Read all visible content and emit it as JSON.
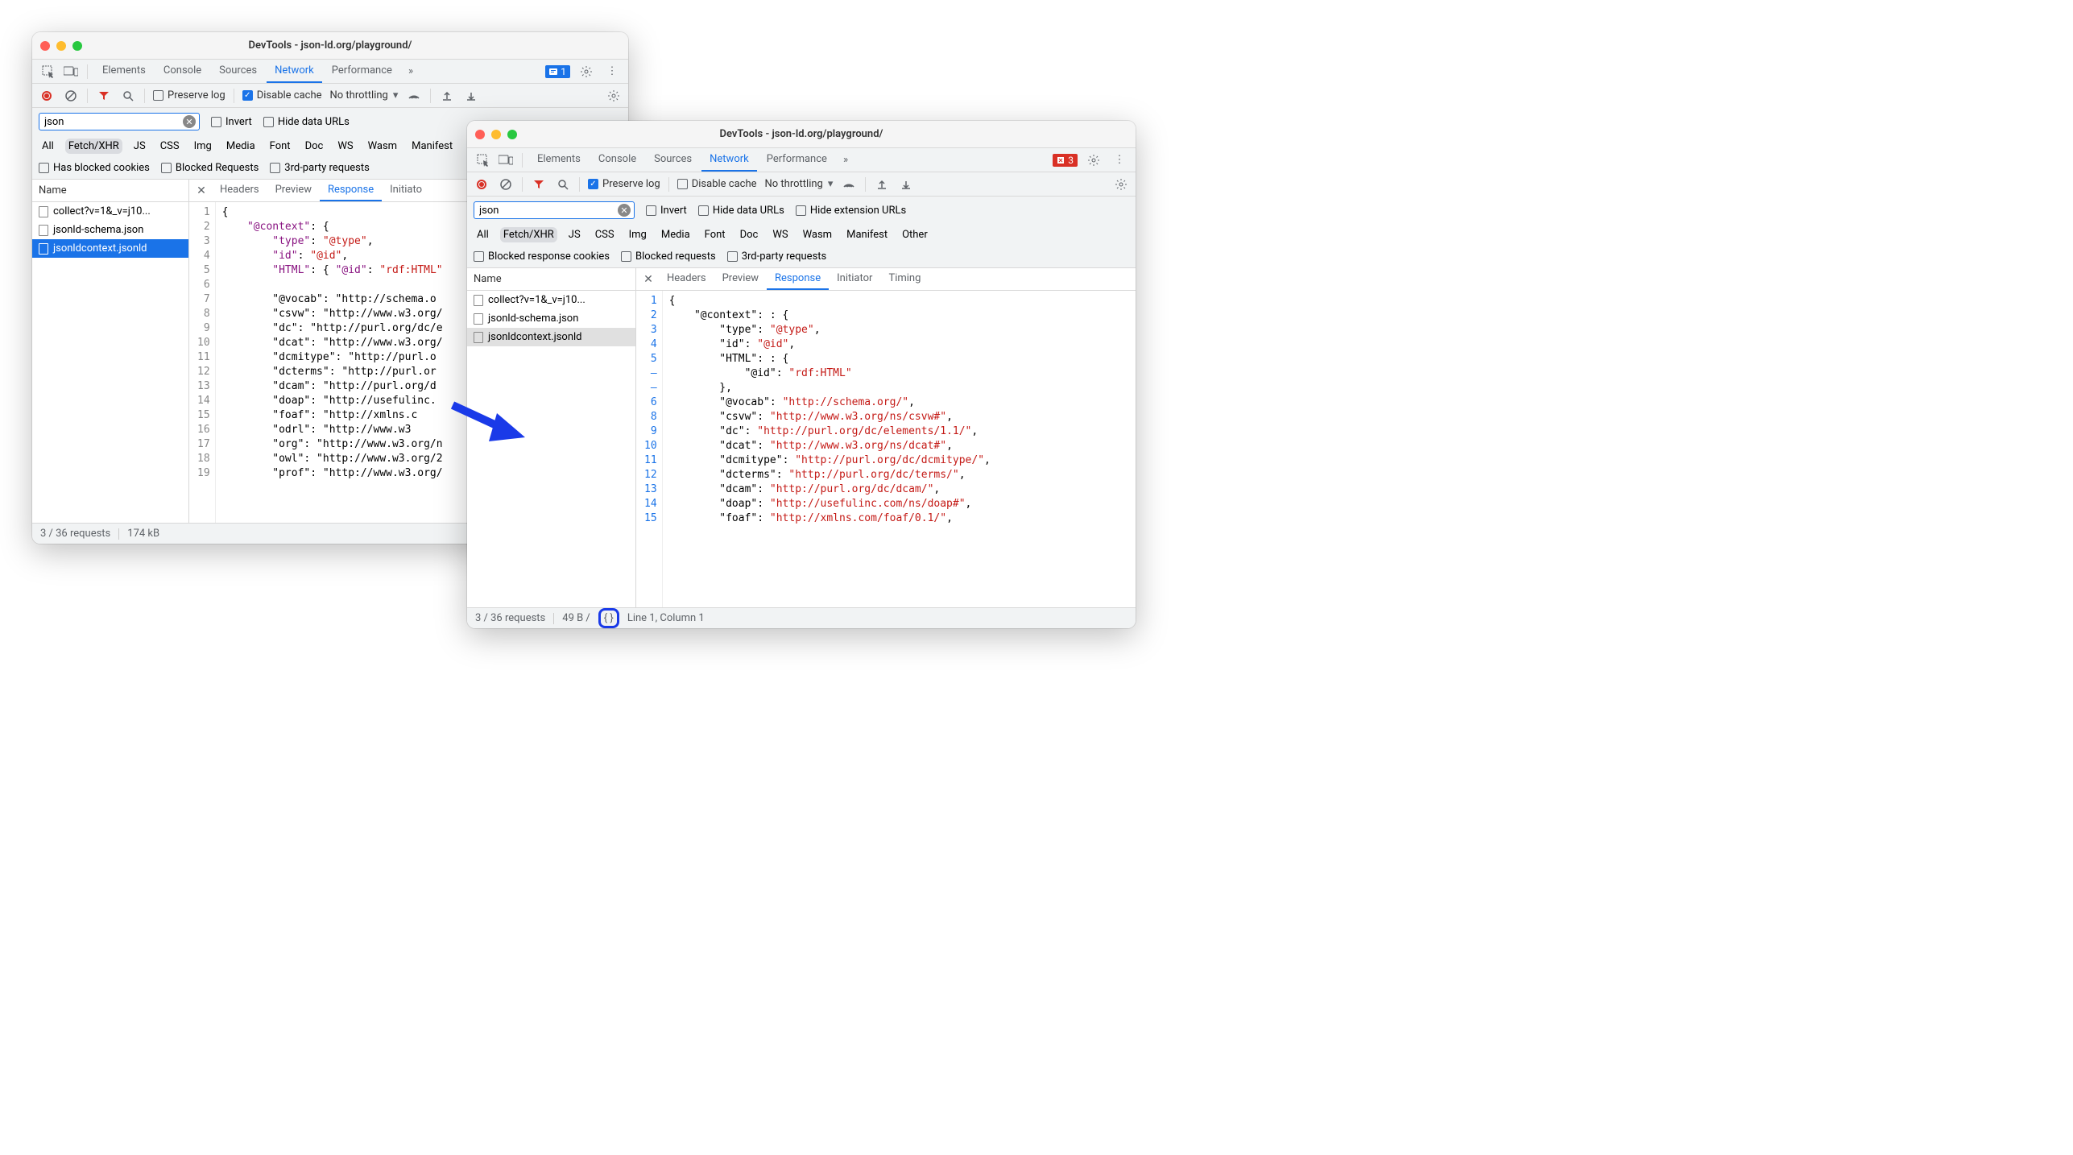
{
  "winA": {
    "title": "DevTools - json-ld.org/playground/",
    "tabs": [
      "Elements",
      "Console",
      "Sources",
      "Network",
      "Performance"
    ],
    "activeTab": "Network",
    "badge": "1",
    "preserve": "Preserve log",
    "disableCache": "Disable cache",
    "throttling": "No throttling",
    "filter": "json",
    "invert": "Invert",
    "hideData": "Hide data URLs",
    "typeFilters": [
      "All",
      "Fetch/XHR",
      "JS",
      "CSS",
      "Img",
      "Media",
      "Font",
      "Doc",
      "WS",
      "Wasm",
      "Manifest"
    ],
    "typeSel": "Fetch/XHR",
    "row2": {
      "hasBlocked": "Has blocked cookies",
      "blockedReq": "Blocked Requests",
      "third": "3rd-party requests"
    },
    "nameCol": "Name",
    "requests": [
      {
        "name": "collect?v=1&_v=j10..."
      },
      {
        "name": "jsonld-schema.json"
      },
      {
        "name": "jsonldcontext.jsonld"
      }
    ],
    "selReq": 2,
    "detailTabs": [
      "Headers",
      "Preview",
      "Response",
      "Initiato"
    ],
    "detailActive": "Response",
    "gutter": [
      "1",
      "2",
      "3",
      "4",
      "5",
      "6",
      "7",
      "8",
      "9",
      "10",
      "11",
      "12",
      "13",
      "14",
      "15",
      "16",
      "17",
      "18",
      "19"
    ],
    "code": [
      "{",
      "    \"@context\": {",
      "        \"type\": \"@type\",",
      "        \"id\": \"@id\",",
      "        \"HTML\": { \"@id\": \"rdf:HTML\"",
      "",
      "        \"@vocab\": \"http://schema.o",
      "        \"csvw\": \"http://www.w3.org/",
      "        \"dc\": \"http://purl.org/dc/e",
      "        \"dcat\": \"http://www.w3.org/",
      "        \"dcmitype\": \"http://purl.o",
      "        \"dcterms\": \"http://purl.or",
      "        \"dcam\": \"http://purl.org/d",
      "        \"doap\": \"http://usefulinc.",
      "        \"foaf\": \"http://xmlns.c",
      "        \"odrl\": \"http://www.w3",
      "        \"org\": \"http://www.w3.org/n",
      "        \"owl\": \"http://www.w3.org/2",
      "        \"prof\": \"http://www.w3.org/"
    ],
    "status": {
      "requests": "3 / 36 requests",
      "size": "174 kB"
    }
  },
  "winB": {
    "title": "DevTools - json-ld.org/playground/",
    "tabs": [
      "Elements",
      "Console",
      "Sources",
      "Network",
      "Performance"
    ],
    "activeTab": "Network",
    "badge": "3",
    "preserve": "Preserve log",
    "disableCache": "Disable cache",
    "throttling": "No throttling",
    "filter": "json",
    "invert": "Invert",
    "hideData": "Hide data URLs",
    "hideExt": "Hide extension URLs",
    "typeFilters": [
      "All",
      "Fetch/XHR",
      "JS",
      "CSS",
      "Img",
      "Media",
      "Font",
      "Doc",
      "WS",
      "Wasm",
      "Manifest",
      "Other"
    ],
    "typeSel": "Fetch/XHR",
    "row2": {
      "blockedResp": "Blocked response cookies",
      "blockedReq": "Blocked requests",
      "third": "3rd-party requests"
    },
    "nameCol": "Name",
    "requests": [
      {
        "name": "collect?v=1&_v=j10..."
      },
      {
        "name": "jsonld-schema.json"
      },
      {
        "name": "jsonldcontext.jsonld"
      }
    ],
    "selReq": 2,
    "detailTabs": [
      "Headers",
      "Preview",
      "Response",
      "Initiator",
      "Timing"
    ],
    "detailActive": "Response",
    "gutter": [
      "1",
      "2",
      "3",
      "4",
      "5",
      "–",
      "–",
      "6",
      "8",
      "9",
      "10",
      "11",
      "12",
      "13",
      "14",
      "15"
    ],
    "code": [
      {
        "ind": 0,
        "t": "{"
      },
      {
        "ind": 1,
        "k": "\"@context\"",
        "t": ": {"
      },
      {
        "ind": 2,
        "k": "\"type\"",
        "v": "\"@type\"",
        "t": ","
      },
      {
        "ind": 2,
        "k": "\"id\"",
        "v": "\"@id\"",
        "t": ","
      },
      {
        "ind": 2,
        "k": "\"HTML\"",
        "t": ": {"
      },
      {
        "ind": 3,
        "k": "\"@id\"",
        "v": "\"rdf:HTML\"",
        "t": ""
      },
      {
        "ind": 2,
        "t": "},"
      },
      {
        "ind": 2,
        "k": "\"@vocab\"",
        "v": "\"http://schema.org/\"",
        "t": ","
      },
      {
        "ind": 2,
        "k": "\"csvw\"",
        "v": "\"http://www.w3.org/ns/csvw#\"",
        "t": ","
      },
      {
        "ind": 2,
        "k": "\"dc\"",
        "v": "\"http://purl.org/dc/elements/1.1/\"",
        "t": ","
      },
      {
        "ind": 2,
        "k": "\"dcat\"",
        "v": "\"http://www.w3.org/ns/dcat#\"",
        "t": ","
      },
      {
        "ind": 2,
        "k": "\"dcmitype\"",
        "v": "\"http://purl.org/dc/dcmitype/\"",
        "t": ","
      },
      {
        "ind": 2,
        "k": "\"dcterms\"",
        "v": "\"http://purl.org/dc/terms/\"",
        "t": ","
      },
      {
        "ind": 2,
        "k": "\"dcam\"",
        "v": "\"http://purl.org/dc/dcam/\"",
        "t": ","
      },
      {
        "ind": 2,
        "k": "\"doap\"",
        "v": "\"http://usefulinc.com/ns/doap#\"",
        "t": ","
      },
      {
        "ind": 2,
        "k": "\"foaf\"",
        "v": "\"http://xmlns.com/foaf/0.1/\"",
        "t": ","
      }
    ],
    "status": {
      "requests": "3 / 36 requests",
      "size": "49 B /",
      "pretty": "{ }",
      "cursor": "Line 1, Column 1"
    }
  }
}
